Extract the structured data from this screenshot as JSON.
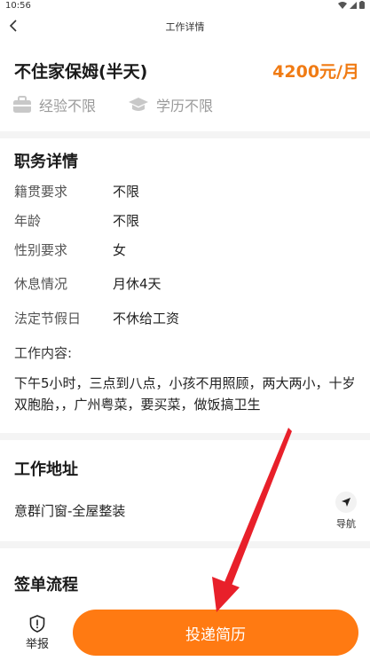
{
  "status_bar": {
    "time": "10:56"
  },
  "nav": {
    "title": "工作详情"
  },
  "job": {
    "title": "不住家保姆(半天)",
    "salary": "4200元/月",
    "tags": {
      "experience": "经验不限",
      "education": "学历不限"
    }
  },
  "details": {
    "title": "职务详情",
    "rows": [
      {
        "label": "籍贯要求",
        "value": "不限"
      },
      {
        "label": "年龄",
        "value": "不限"
      },
      {
        "label": "性别要求",
        "value": "女"
      },
      {
        "label": "休息情况",
        "value": "月休4天"
      },
      {
        "label": "法定节假日",
        "value": "不休给工资"
      }
    ],
    "work_content_label": "工作内容:",
    "work_content": "下午5小时，三点到八点，小孩不用照顾，两大两小，十岁双胞胎，，广州粤菜，要买菜，做饭搞卫生"
  },
  "address": {
    "title": "工作地址",
    "text": "意群门窗-全屋整装",
    "nav_label": "导航"
  },
  "contract": {
    "title": "签单流程"
  },
  "bottom": {
    "report_label": "举报",
    "apply_label": "投递简历"
  },
  "colors": {
    "accent": "#ff7a12",
    "salary": "#f07b14",
    "arrow": "#e8202a"
  }
}
